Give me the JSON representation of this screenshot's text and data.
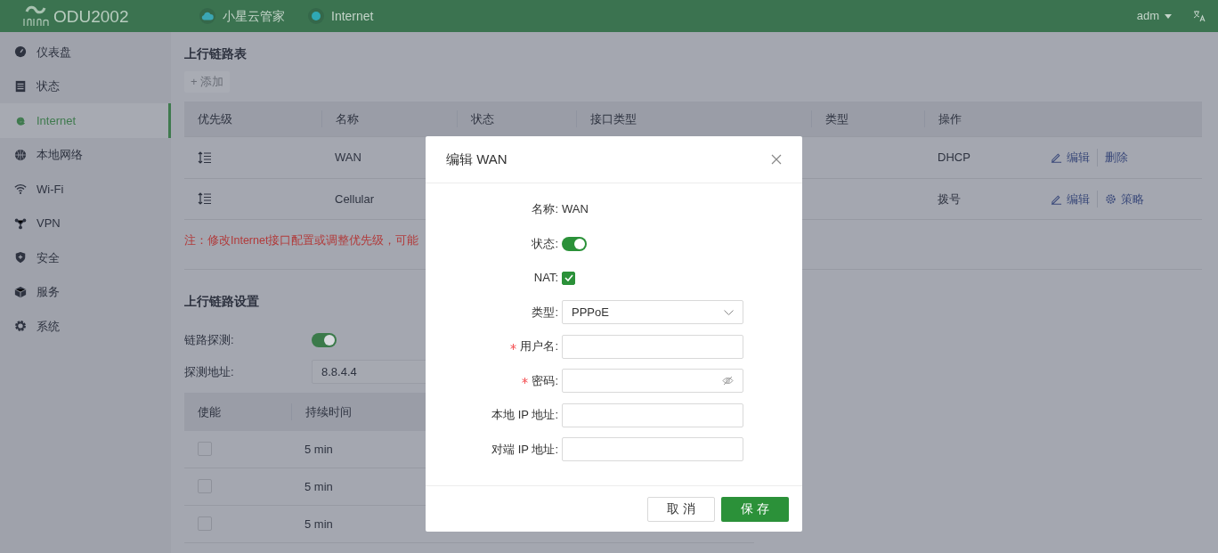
{
  "header": {
    "product": "ODU2002",
    "nav": [
      {
        "label": "小星云管家",
        "kind": "cloud"
      },
      {
        "label": "Internet",
        "kind": "dot"
      }
    ],
    "user": "adm"
  },
  "sidebar": {
    "items": [
      {
        "label": "仪表盘",
        "selected": false
      },
      {
        "label": "状态",
        "selected": false
      },
      {
        "label": "Internet",
        "selected": true
      },
      {
        "label": "本地网络",
        "selected": false
      },
      {
        "label": "Wi-Fi",
        "selected": false
      },
      {
        "label": "VPN",
        "selected": false
      },
      {
        "label": "安全",
        "selected": false
      },
      {
        "label": "服务",
        "selected": false
      },
      {
        "label": "系统",
        "selected": false
      }
    ]
  },
  "uplink_table": {
    "title": "上行链路表",
    "add_button": "+ 添加",
    "columns": [
      "优先级",
      "名称",
      "状态",
      "接口类型",
      "类型",
      "操作"
    ],
    "rows": [
      {
        "name": "WAN",
        "type": "DHCP",
        "actions": [
          "编辑",
          "删除"
        ]
      },
      {
        "name": "Cellular",
        "type": "拨号",
        "actions": [
          "编辑",
          "策略"
        ]
      }
    ],
    "note": "注：修改Internet接口配置或调整优先级，可能"
  },
  "uplink_settings": {
    "title": "上行链路设置",
    "probe_label": "链路探测:",
    "probe_on": true,
    "address_label": "探测地址:",
    "address": "8.8.4.4",
    "columns": [
      "使能",
      "持续时间"
    ],
    "rows": [
      {
        "checked": false,
        "duration": "5 min"
      },
      {
        "checked": false,
        "duration": "5 min"
      },
      {
        "checked": false,
        "duration": "5 min"
      }
    ]
  },
  "dialog": {
    "title": "编辑 WAN",
    "name_label": "名称:",
    "name_value": "WAN",
    "fields": [
      {
        "kind": "switch",
        "label": "状态:",
        "on": true
      },
      {
        "kind": "checkbox",
        "label": "NAT:",
        "checked": true
      },
      {
        "kind": "select",
        "label": "类型:",
        "value": "PPPoE"
      },
      {
        "kind": "text",
        "label": "用户名:",
        "required": true
      },
      {
        "kind": "password",
        "label": "密码:",
        "required": true
      },
      {
        "kind": "text",
        "label": "本地 IP 地址:",
        "required": false
      },
      {
        "kind": "text",
        "label": "对端 IP 地址:",
        "required": false
      }
    ],
    "buttons": [
      {
        "label": "取 消",
        "primary": false
      },
      {
        "label": "保 存",
        "primary": true
      }
    ]
  }
}
